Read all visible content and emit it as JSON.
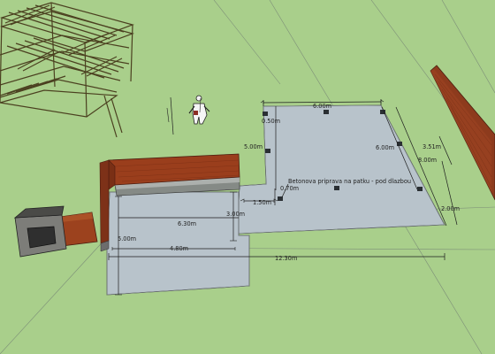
{
  "scene": {
    "dimensions": {
      "top_width": "6.00m",
      "right_depth": "6.00m",
      "left_height": "5.00m",
      "small_gap": "0.50m",
      "offset_right": "3.51m",
      "overall_depth": "8.00m",
      "front_right": "2.00m",
      "patio_width": "6.30m",
      "patio_depth": "3.00m",
      "connector": "1.50m",
      "pad_gap": "0.70m",
      "lower_width": "4.80m",
      "lower_depth": "5.00m",
      "total_length": "12.30m"
    },
    "annotation": "Betonova priprava na patku - pod dlazbou"
  }
}
